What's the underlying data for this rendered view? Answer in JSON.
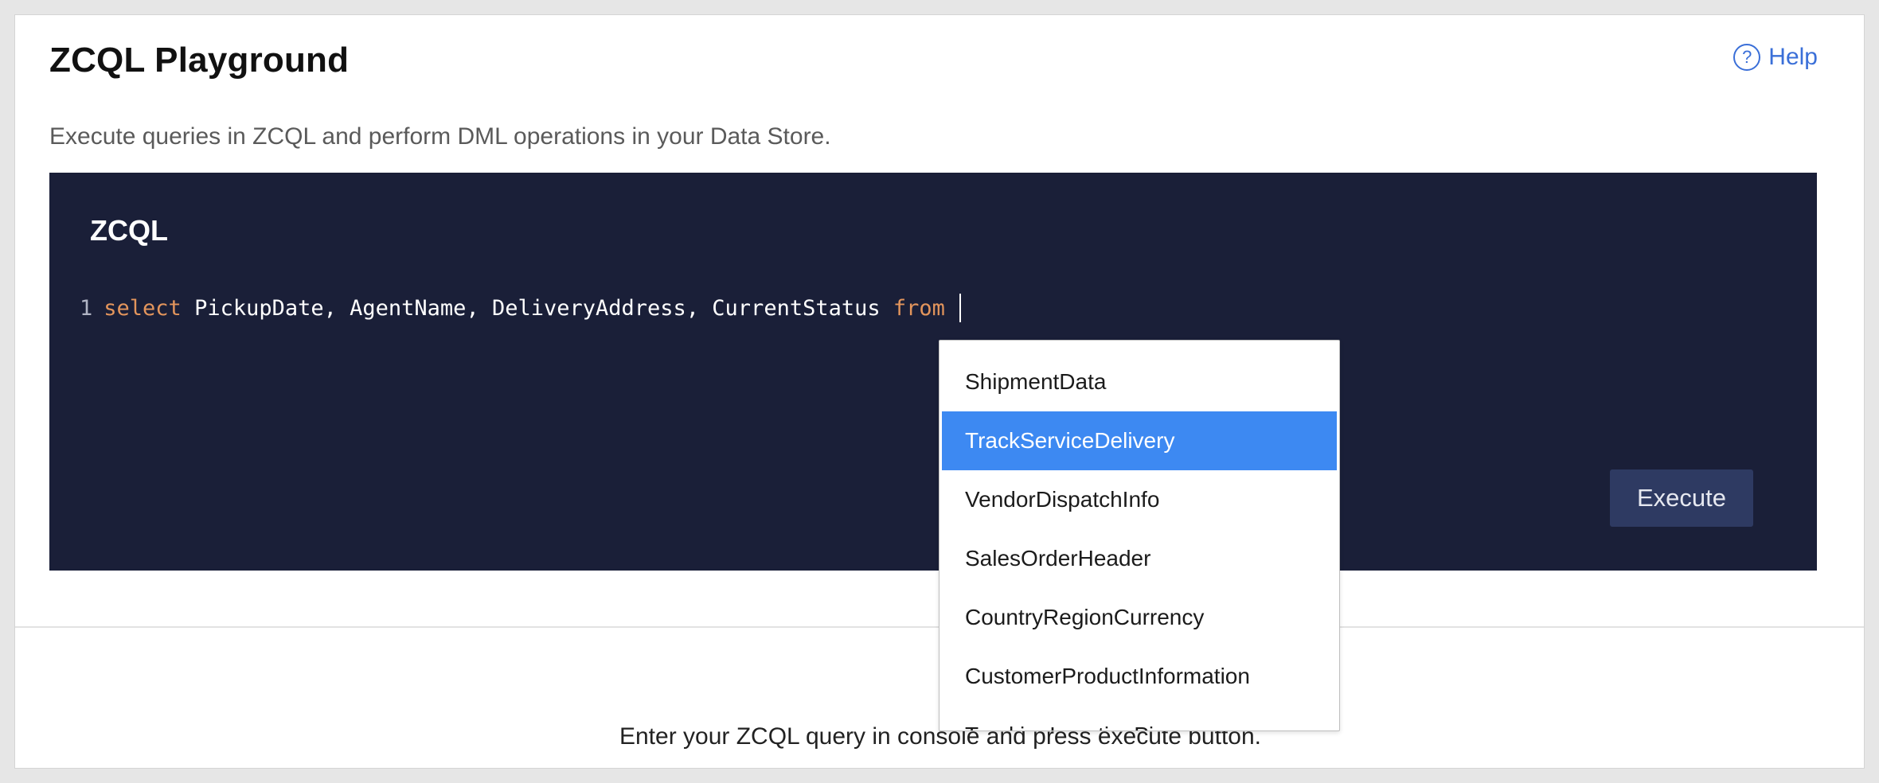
{
  "header": {
    "title": "ZCQL Playground",
    "subtitle": "Execute queries in ZCQL and perform DML operations in your Data Store.",
    "help_icon": "question-circle-icon",
    "help_label": "Help"
  },
  "console": {
    "title": "ZCQL",
    "line_number": "1",
    "query": {
      "keyword_select": "select",
      "columns": "PickupDate, AgentName, DeliveryAddress, CurrentStatus",
      "keyword_from": "from"
    },
    "execute_label": "Execute"
  },
  "autocomplete": {
    "selected_index": 1,
    "items": [
      "ShipmentData",
      "TrackServiceDelivery",
      "VendorDispatchInfo",
      "SalesOrderHeader",
      "CountryRegionCurrency",
      "CustomerProductInformation",
      "TrackingLocationPins"
    ]
  },
  "results": {
    "hint": "Enter your ZCQL query in console and press execute button."
  },
  "colors": {
    "console_bg": "#1a1f38",
    "keyword": "#e3955c",
    "selection": "#3d89f2",
    "link": "#3a6fd8",
    "execute_button": "#2e3a62"
  }
}
